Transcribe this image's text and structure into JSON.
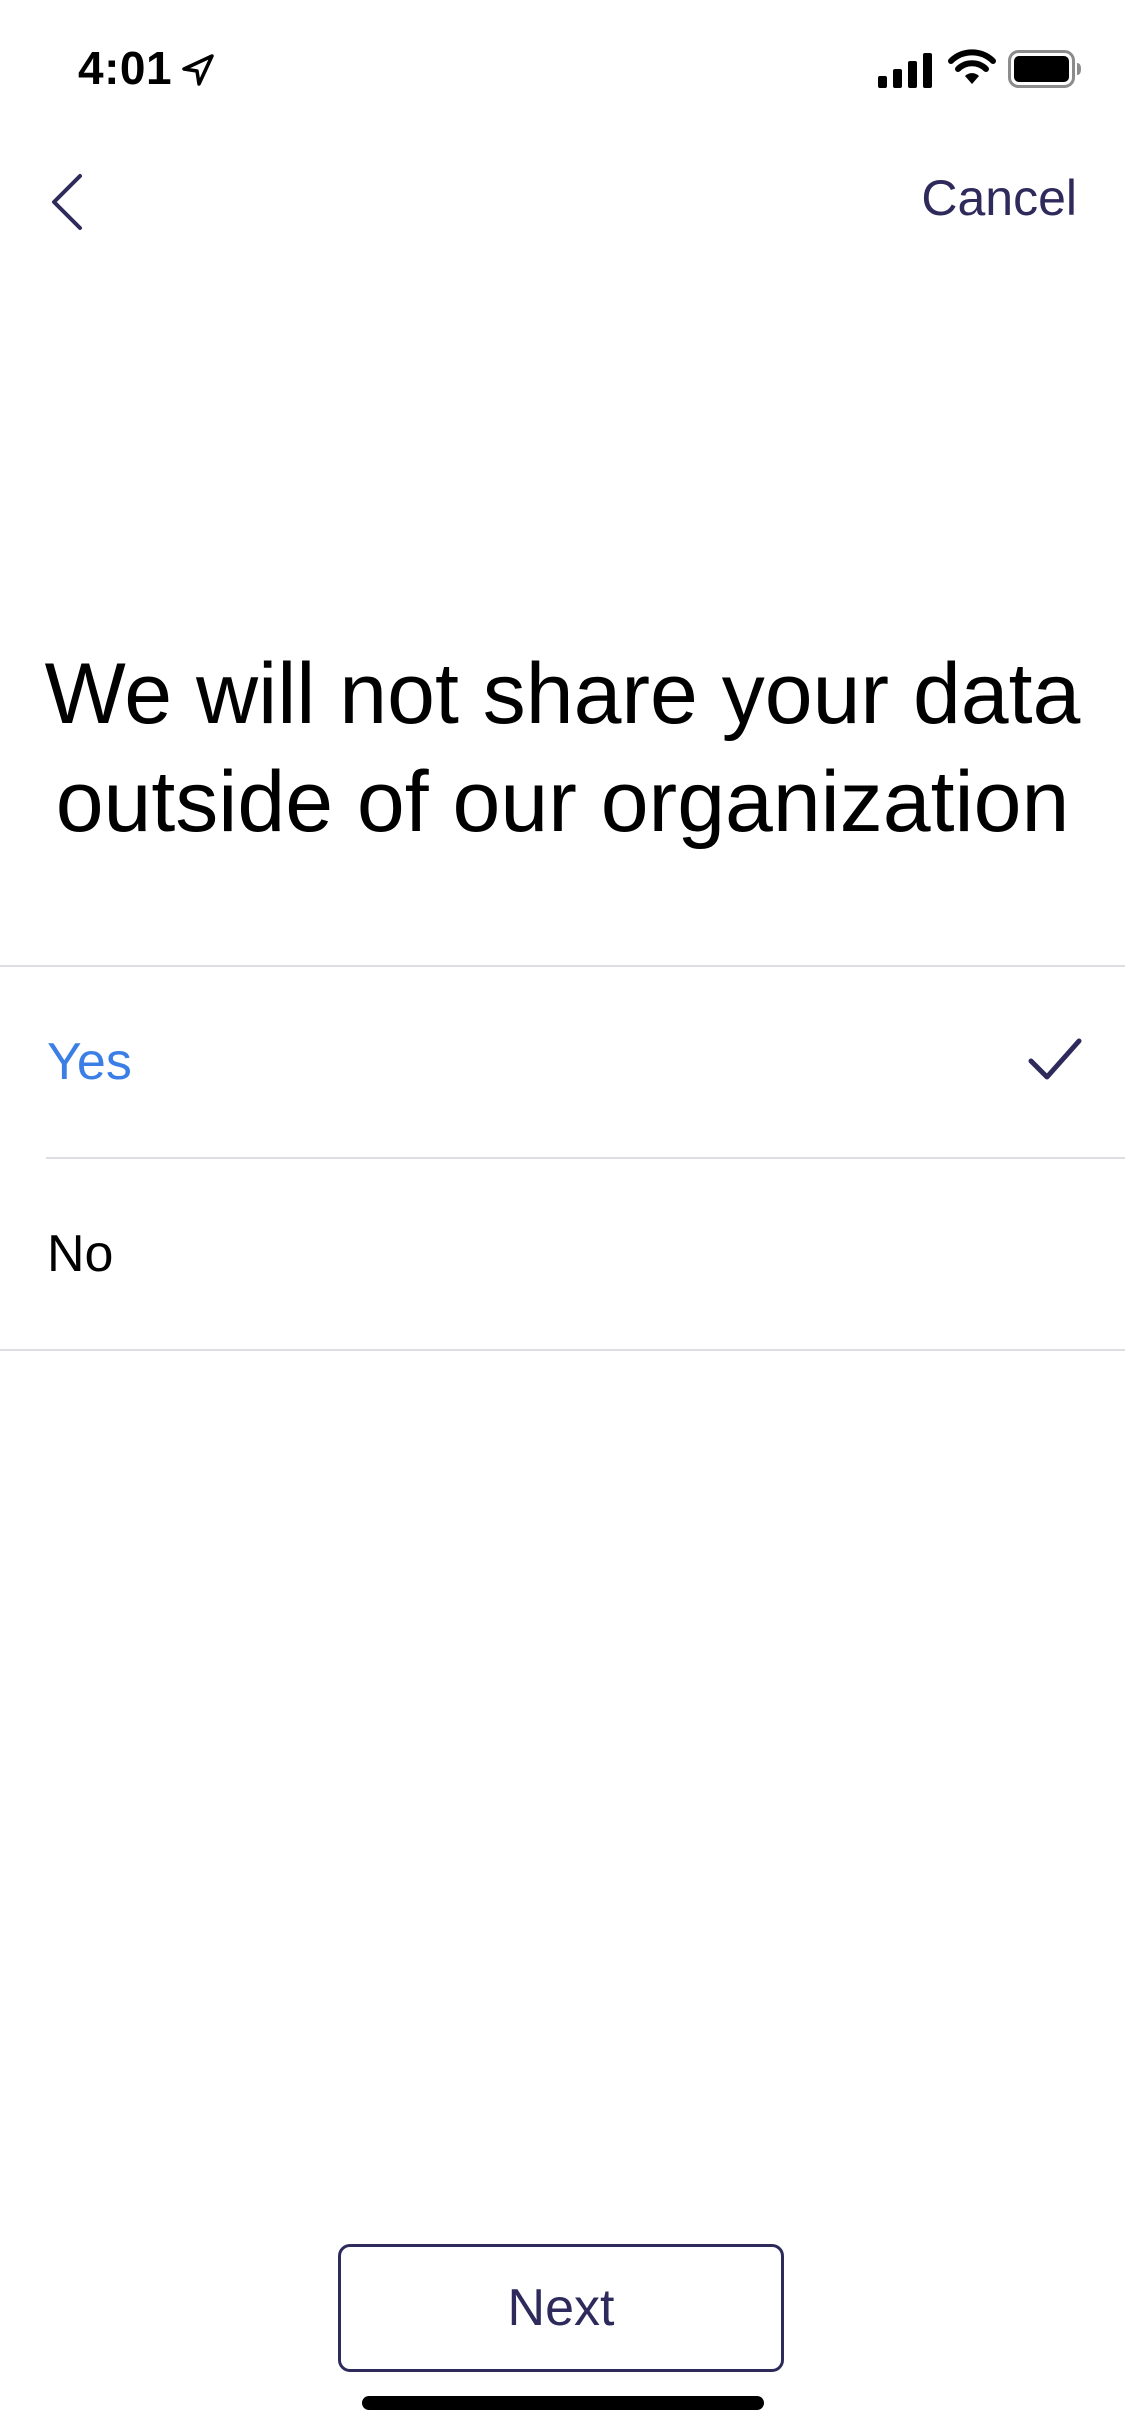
{
  "status_bar": {
    "time": "4:01",
    "icons": [
      "location-arrow-icon",
      "cellular-signal-icon",
      "wifi-icon",
      "battery-icon"
    ]
  },
  "nav": {
    "back_icon": "chevron-left-icon",
    "cancel_label": "Cancel"
  },
  "question": {
    "title": "We will not share your data outside of our organization"
  },
  "options": [
    {
      "label": "Yes",
      "selected": true
    },
    {
      "label": "No",
      "selected": false
    }
  ],
  "footer": {
    "next_label": "Next"
  },
  "colors": {
    "accent": "#2e2a5c",
    "selected_text": "#3b7fe6",
    "divider": "#dedee2",
    "background": "#ffffff"
  }
}
